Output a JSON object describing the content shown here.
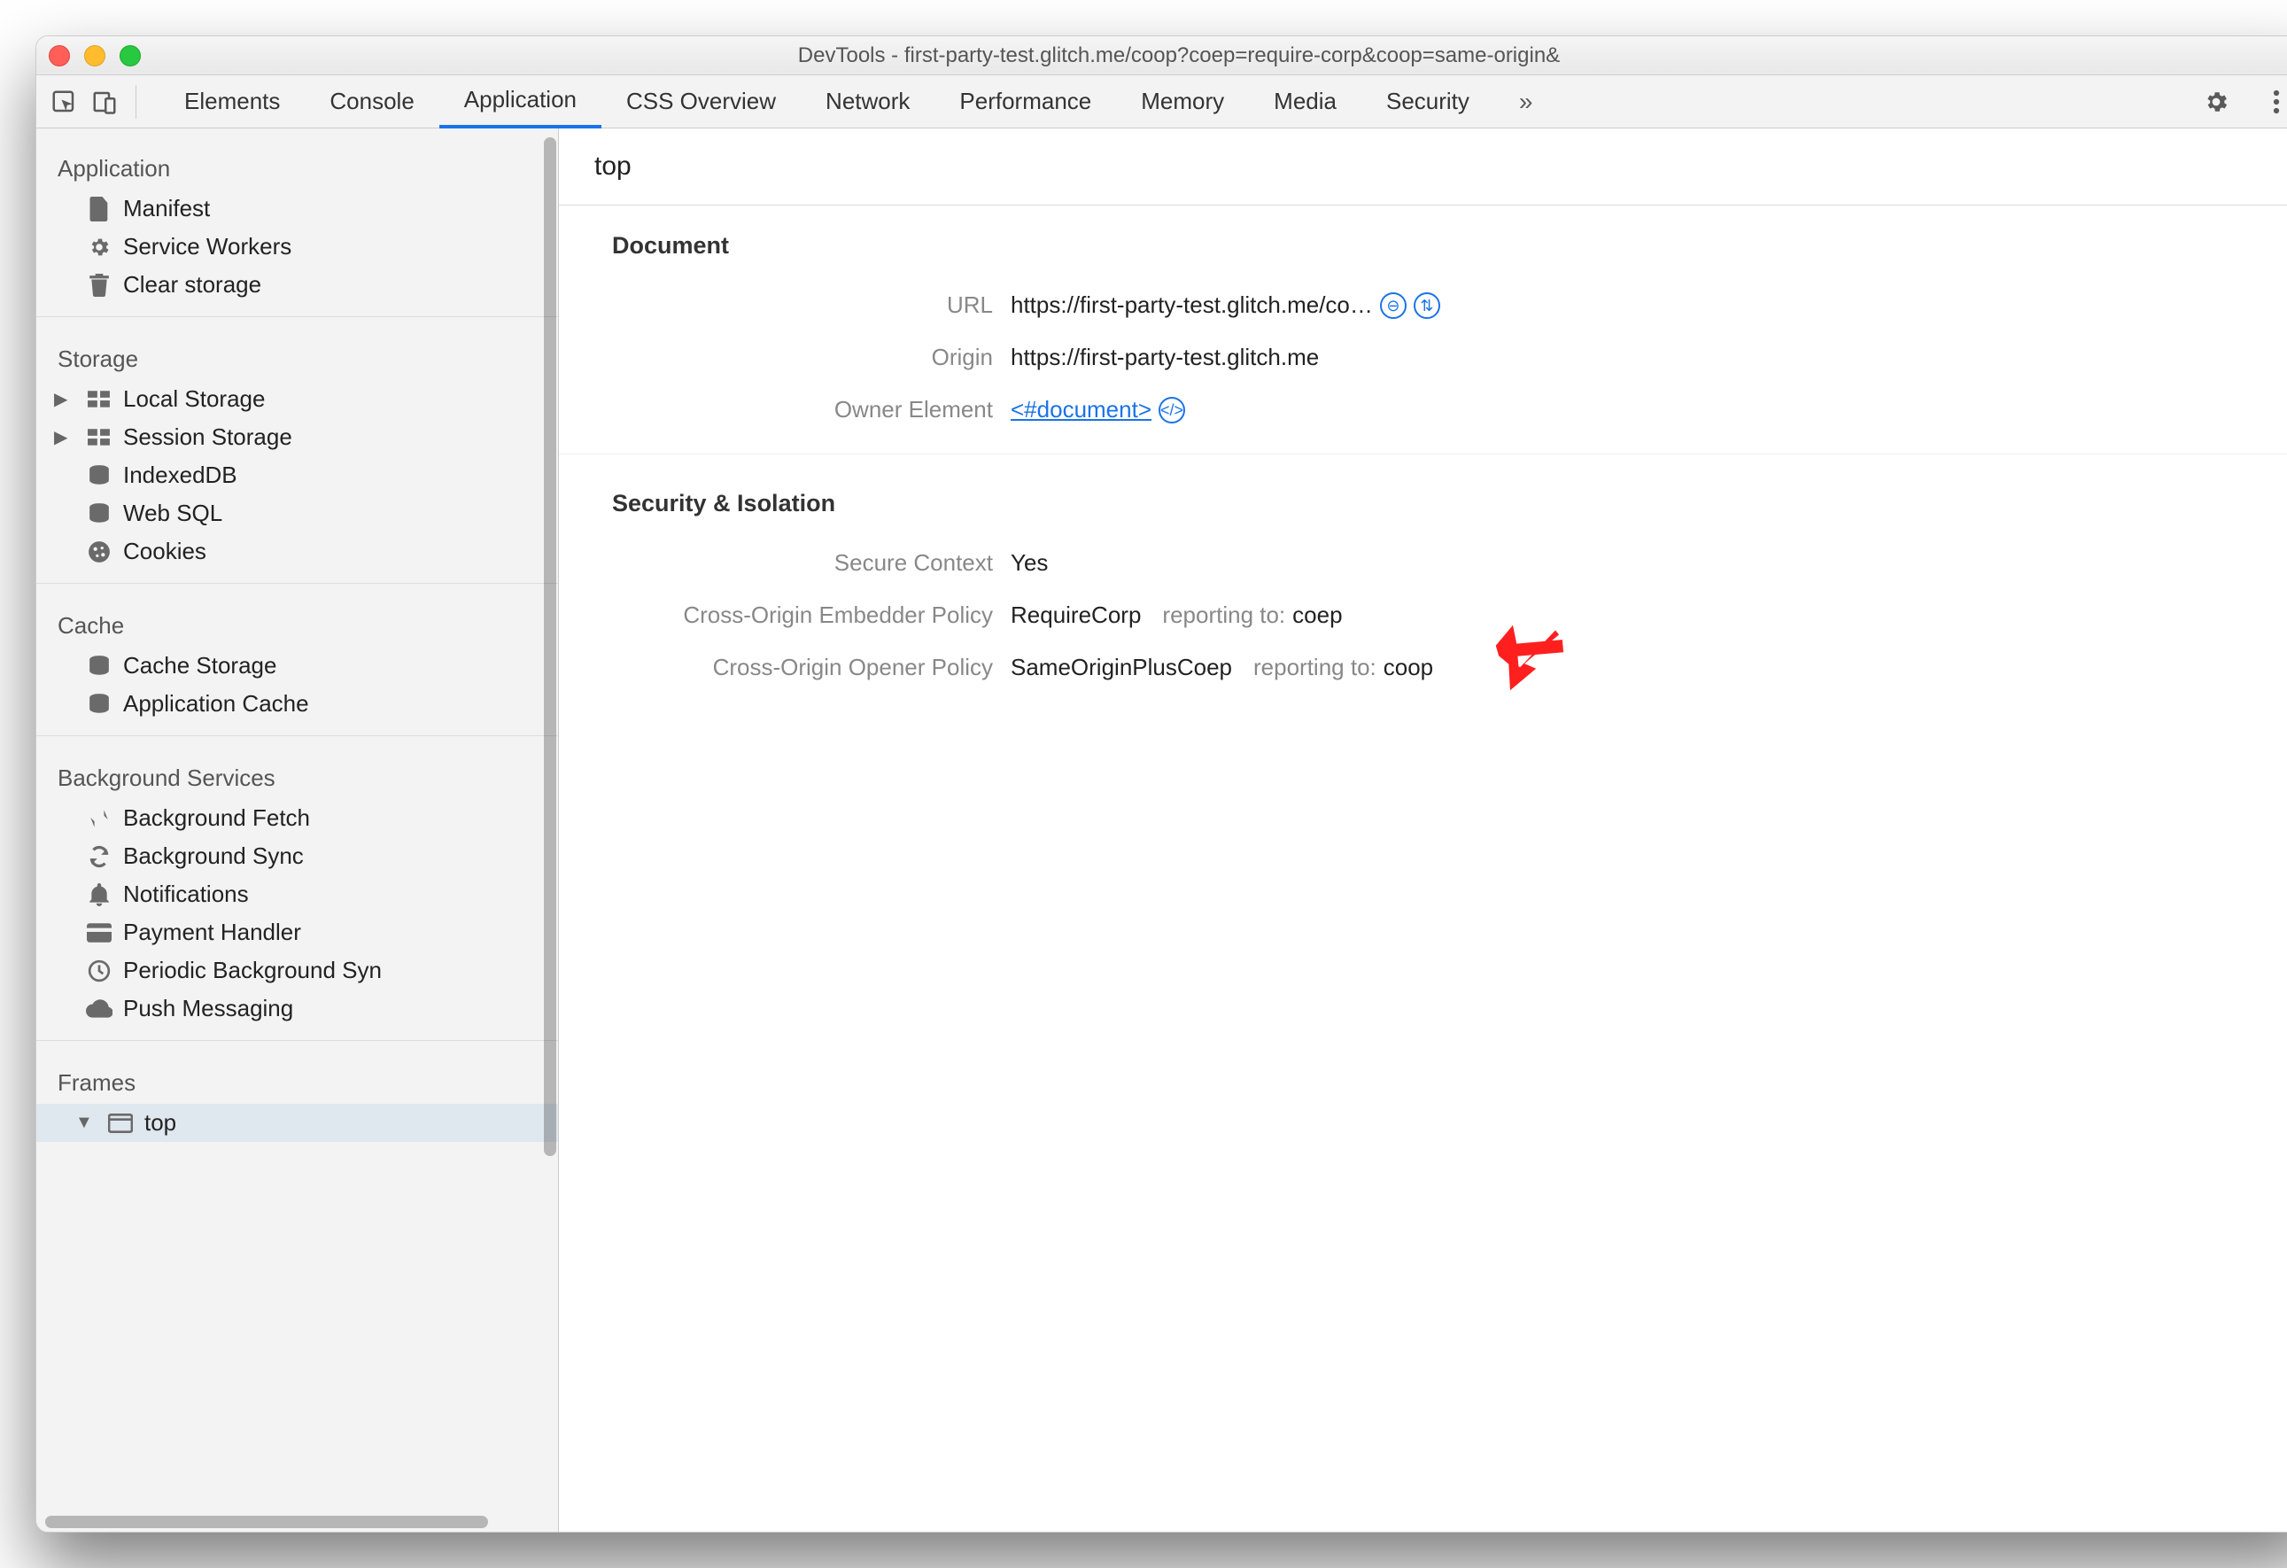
{
  "window": {
    "title": "DevTools - first-party-test.glitch.me/coop?coep=require-corp&coop=same-origin&"
  },
  "tabs": {
    "items": [
      "Elements",
      "Console",
      "Application",
      "CSS Overview",
      "Network",
      "Performance",
      "Memory",
      "Media",
      "Security"
    ],
    "active_index": 2
  },
  "sidebar": {
    "sections": [
      {
        "title": "Application",
        "items": [
          {
            "label": "Manifest",
            "icon": "file-icon"
          },
          {
            "label": "Service Workers",
            "icon": "gear-icon"
          },
          {
            "label": "Clear storage",
            "icon": "trash-icon"
          }
        ]
      },
      {
        "title": "Storage",
        "items": [
          {
            "label": "Local Storage",
            "icon": "grid-icon",
            "expandable": true
          },
          {
            "label": "Session Storage",
            "icon": "grid-icon",
            "expandable": true
          },
          {
            "label": "IndexedDB",
            "icon": "db-icon"
          },
          {
            "label": "Web SQL",
            "icon": "db-icon"
          },
          {
            "label": "Cookies",
            "icon": "cookie-icon"
          }
        ]
      },
      {
        "title": "Cache",
        "items": [
          {
            "label": "Cache Storage",
            "icon": "db-icon"
          },
          {
            "label": "Application Cache",
            "icon": "db-icon"
          }
        ]
      },
      {
        "title": "Background Services",
        "items": [
          {
            "label": "Background Fetch",
            "icon": "transfer-icon"
          },
          {
            "label": "Background Sync",
            "icon": "sync-icon"
          },
          {
            "label": "Notifications",
            "icon": "bell-icon"
          },
          {
            "label": "Payment Handler",
            "icon": "card-icon"
          },
          {
            "label": "Periodic Background Syn",
            "icon": "clock-icon"
          },
          {
            "label": "Push Messaging",
            "icon": "cloud-icon"
          }
        ]
      },
      {
        "title": "Frames",
        "items": [
          {
            "label": "top",
            "icon": "window-icon",
            "expandable": true,
            "expanded": true,
            "selected": true
          }
        ]
      }
    ]
  },
  "main": {
    "heading": "top",
    "document_section": {
      "title": "Document",
      "url_label": "URL",
      "url_value": "https://first-party-test.glitch.me/co…",
      "origin_label": "Origin",
      "origin_value": "https://first-party-test.glitch.me",
      "owner_label": "Owner Element",
      "owner_link": "<#document>"
    },
    "security_section": {
      "title": "Security & Isolation",
      "secure_label": "Secure Context",
      "secure_value": "Yes",
      "coep_label": "Cross-Origin Embedder Policy",
      "coep_value": "RequireCorp",
      "coep_reporting_label": "reporting to:",
      "coep_reporting_value": "coep",
      "coop_label": "Cross-Origin Opener Policy",
      "coop_value": "SameOriginPlusCoep",
      "coop_reporting_label": "reporting to:",
      "coop_reporting_value": "coop"
    }
  }
}
